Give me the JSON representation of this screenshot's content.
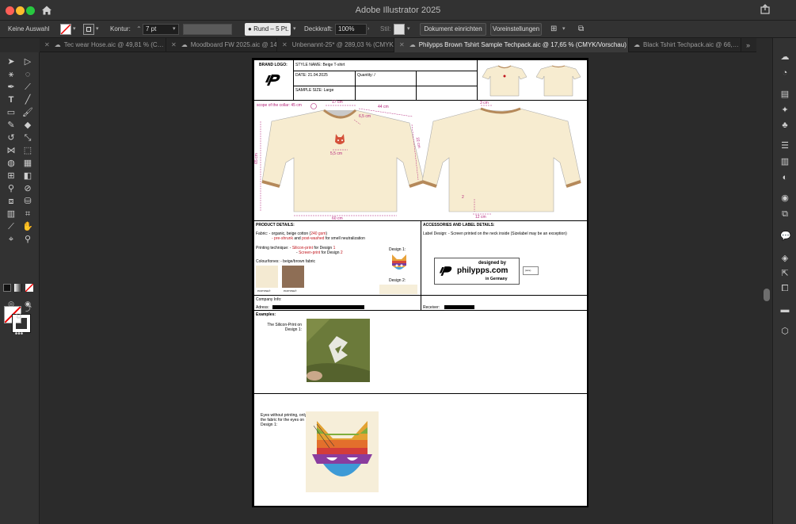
{
  "window": {
    "title": "Adobe Illustrator 2025"
  },
  "control_bar": {
    "selection": "Keine Auswahl",
    "stroke_label": "Kontur:",
    "stroke_weight": "7 pt",
    "brush": "Rund – 5 Pt.",
    "opacity_label": "Deckkraft:",
    "opacity_value": "100%",
    "style_label": "Stil:",
    "document_setup": "Dokument einrichten",
    "preferences": "Voreinstellungen"
  },
  "tabs": [
    {
      "label": "Tec wear Hose.aic @ 49,81 % (C…",
      "cloud": true,
      "active": false
    },
    {
      "label": "Moodboard FW 2025.aic @ 147,…",
      "cloud": true,
      "active": false
    },
    {
      "label": "Unbenannt-25* @ 289,03 % (CMYK…",
      "cloud": false,
      "active": false
    },
    {
      "label": "Philypps Brown Tshirt Sample Techpack.aic @ 17,65 % (CMYK/Vorschau)",
      "cloud": true,
      "active": true
    },
    {
      "label": "Black Tshirt Techpack.aic @ 66,…",
      "cloud": true,
      "active": false
    }
  ],
  "techpack": {
    "brand_logo_label": "BRAND LOGO:",
    "style_name": "STYLE NAME: Beige T-shirt",
    "date": "DATE: 21.04.2025",
    "quantity": "Quantity: /",
    "sample_size": "SAMPLE SIZE: Large",
    "measures": {
      "collar_scope": "scope of the collar: 45 cm",
      "collar_width": "17 cm",
      "shoulder": "44 cm",
      "neck_drop": "6,5 cm",
      "sleeve": "22 cm",
      "length": "65 cm",
      "print_width": "5,5 cm",
      "bottom_width": "60 cm",
      "back_collar": "3 cm",
      "hem": "2",
      "hem_width": "12 cm"
    },
    "product_details": {
      "title": "PRODUCT DETAILS:",
      "fabric_prefix": "Fabric: - organic, beige cotton (",
      "fabric_gsm": "240 gsm",
      "fabric_suffix": ")",
      "preshrunk": "- pre-shrunk",
      "and": " and ",
      "postwashed": "post-washed",
      "neutral": " for smell neutralization",
      "printing_prefix": "Printing technique: - ",
      "silicon": "Silicon-print",
      "for_design1": " for Design ",
      "d1": "1",
      "screen_prefix": "- ",
      "screen": "Screen-print",
      "for_design2": " for Design ",
      "d2": "2",
      "colour": "Colour/tones: - beige/brown fabric",
      "design1": "Design 1:",
      "design2": "Design 2:",
      "pantone1": "PANTONE®",
      "pantone2": "PANTONE®"
    },
    "accessories": {
      "title": "ACCESSORIES AND LABEL DETAILS:",
      "label_design": "Label Design: - Screen printed on the neck inside (Sizelabel may be an exception)",
      "designed_by": "designed by",
      "domain": "philypps.com",
      "in_germany": "in Germany",
      "size_tag": "(size)"
    },
    "company_info": "Company Info:",
    "adress": "Adress:",
    "receiver": "Receiver:",
    "examples": "Examples:",
    "example1": "The Silicon-Print on Design 1:",
    "example2": "Eyes without printing, only the fabric for the eyes on Design 1:"
  }
}
